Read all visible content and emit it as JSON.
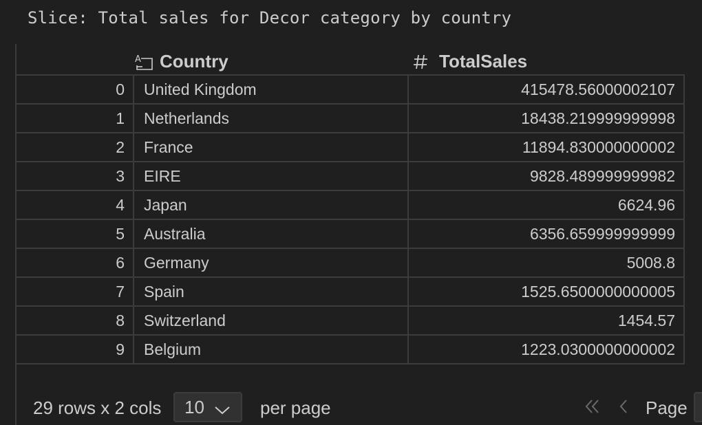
{
  "slice_title": "Slice: Total sales for Decor category by country",
  "columns": {
    "country": {
      "label": "Country",
      "icon": "text-type-icon"
    },
    "total_sales": {
      "label": "TotalSales",
      "icon": "number-type-icon"
    }
  },
  "rows": [
    {
      "index": "0",
      "country": "United Kingdom",
      "total_sales": "415478.56000002107"
    },
    {
      "index": "1",
      "country": "Netherlands",
      "total_sales": "18438.219999999998"
    },
    {
      "index": "2",
      "country": "France",
      "total_sales": "11894.830000000002"
    },
    {
      "index": "3",
      "country": "EIRE",
      "total_sales": "9828.489999999982"
    },
    {
      "index": "4",
      "country": "Japan",
      "total_sales": "6624.96"
    },
    {
      "index": "5",
      "country": "Australia",
      "total_sales": "6356.659999999999"
    },
    {
      "index": "6",
      "country": "Germany",
      "total_sales": "5008.8"
    },
    {
      "index": "7",
      "country": "Spain",
      "total_sales": "1525.6500000000005"
    },
    {
      "index": "8",
      "country": "Switzerland",
      "total_sales": "1454.57"
    },
    {
      "index": "9",
      "country": "Belgium",
      "total_sales": "1223.0300000000002"
    }
  ],
  "footer": {
    "rows_info": "29 rows x 2 cols",
    "page_size": "10",
    "per_page_label": "per page",
    "page_label": "Page",
    "first_icon": "double-chevron-left-icon",
    "prev_icon": "chevron-left-icon"
  }
}
